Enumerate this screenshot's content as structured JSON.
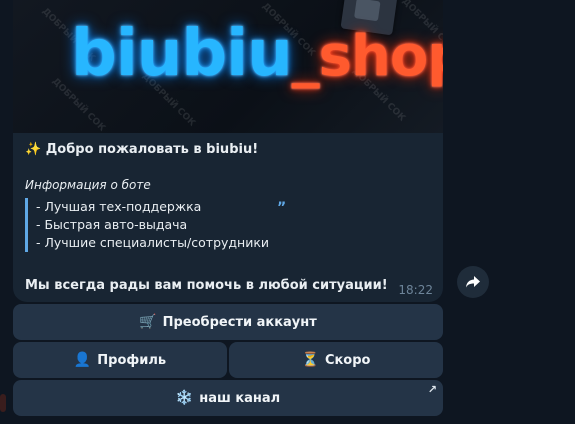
{
  "banner": {
    "logo_part1": "biubiu",
    "logo_part2": "_shop",
    "watermark": "ДОБРЫЙ СОК"
  },
  "message": {
    "welcome_icon": "✨",
    "welcome": "Добро пожаловать в biubiu!",
    "info_title": "Информация о боте",
    "quote_lines": [
      "- Лучшая тех-поддержка",
      "- Быстрая авто-выдача",
      "- Лучшие специалисты/сотрудники"
    ],
    "quote_mark": "”",
    "closing": "Мы всегда рады вам помочь в любой ситуации!",
    "time": "18:22"
  },
  "keyboard": {
    "buy": {
      "icon": "🛒",
      "label": "Преобрести аккаунт"
    },
    "profile": {
      "icon": "👤",
      "label": "Профиль"
    },
    "soon": {
      "icon": "⏳",
      "label": "Скоро"
    },
    "channel": {
      "icon": "❄️",
      "label": "наш канал",
      "corner": "↗"
    }
  },
  "icons": {
    "share": "share-arrow-icon"
  },
  "colors": {
    "background": "#0e1621",
    "bubble": "#182533",
    "button": "#243447",
    "accent": "#5fa8e6",
    "logo_blue": "#27b6ff",
    "logo_red": "#ff5a2e"
  }
}
